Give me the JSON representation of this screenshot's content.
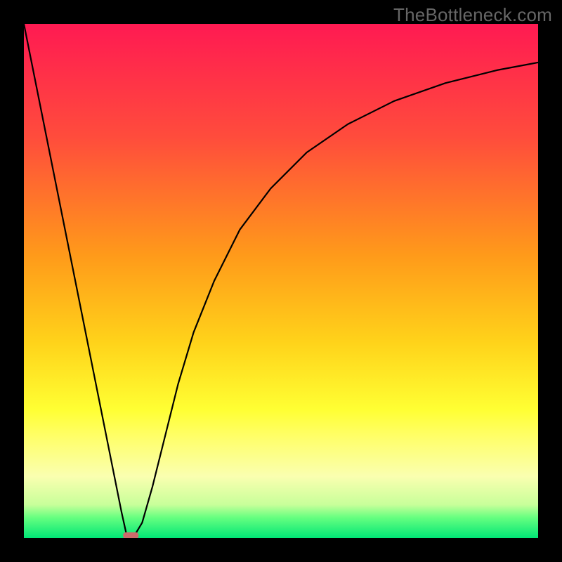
{
  "watermark": "TheBottleneck.com",
  "chart_data": {
    "type": "line",
    "title": "",
    "xlabel": "",
    "ylabel": "",
    "xlim": [
      0,
      100
    ],
    "ylim": [
      0,
      100
    ],
    "grid": false,
    "background_gradient": {
      "stops": [
        {
          "offset": 0,
          "color": "#ff1a52"
        },
        {
          "offset": 22,
          "color": "#ff4c3c"
        },
        {
          "offset": 45,
          "color": "#ff9a1a"
        },
        {
          "offset": 62,
          "color": "#ffd31a"
        },
        {
          "offset": 75,
          "color": "#ffff33"
        },
        {
          "offset": 80,
          "color": "#ffff66"
        },
        {
          "offset": 88,
          "color": "#faffb0"
        },
        {
          "offset": 93.5,
          "color": "#c8ff9a"
        },
        {
          "offset": 96,
          "color": "#66ff80"
        },
        {
          "offset": 100,
          "color": "#00e676"
        }
      ]
    },
    "curve": {
      "description": "V-shaped bottleneck curve: steep linear drop from top-left to minimum, then log-like rise to top-right",
      "points": [
        {
          "x": 0.0,
          "y": 100.0
        },
        {
          "x": 2.5,
          "y": 87.5
        },
        {
          "x": 5.0,
          "y": 75.0
        },
        {
          "x": 7.5,
          "y": 62.5
        },
        {
          "x": 10.0,
          "y": 50.0
        },
        {
          "x": 12.5,
          "y": 37.5
        },
        {
          "x": 15.0,
          "y": 25.0
        },
        {
          "x": 17.5,
          "y": 12.5
        },
        {
          "x": 19.0,
          "y": 5.0
        },
        {
          "x": 20.0,
          "y": 0.5
        },
        {
          "x": 21.5,
          "y": 0.5
        },
        {
          "x": 23.0,
          "y": 3.0
        },
        {
          "x": 25.0,
          "y": 10.0
        },
        {
          "x": 27.5,
          "y": 20.0
        },
        {
          "x": 30.0,
          "y": 30.0
        },
        {
          "x": 33.0,
          "y": 40.0
        },
        {
          "x": 37.0,
          "y": 50.0
        },
        {
          "x": 42.0,
          "y": 60.0
        },
        {
          "x": 48.0,
          "y": 68.0
        },
        {
          "x": 55.0,
          "y": 75.0
        },
        {
          "x": 63.0,
          "y": 80.5
        },
        {
          "x": 72.0,
          "y": 85.0
        },
        {
          "x": 82.0,
          "y": 88.5
        },
        {
          "x": 92.0,
          "y": 91.0
        },
        {
          "x": 100.0,
          "y": 92.5
        }
      ]
    },
    "marker": {
      "x": 20.8,
      "y": 0.5,
      "width": 3.0,
      "height": 1.3,
      "color": "#cc6b6b"
    }
  }
}
